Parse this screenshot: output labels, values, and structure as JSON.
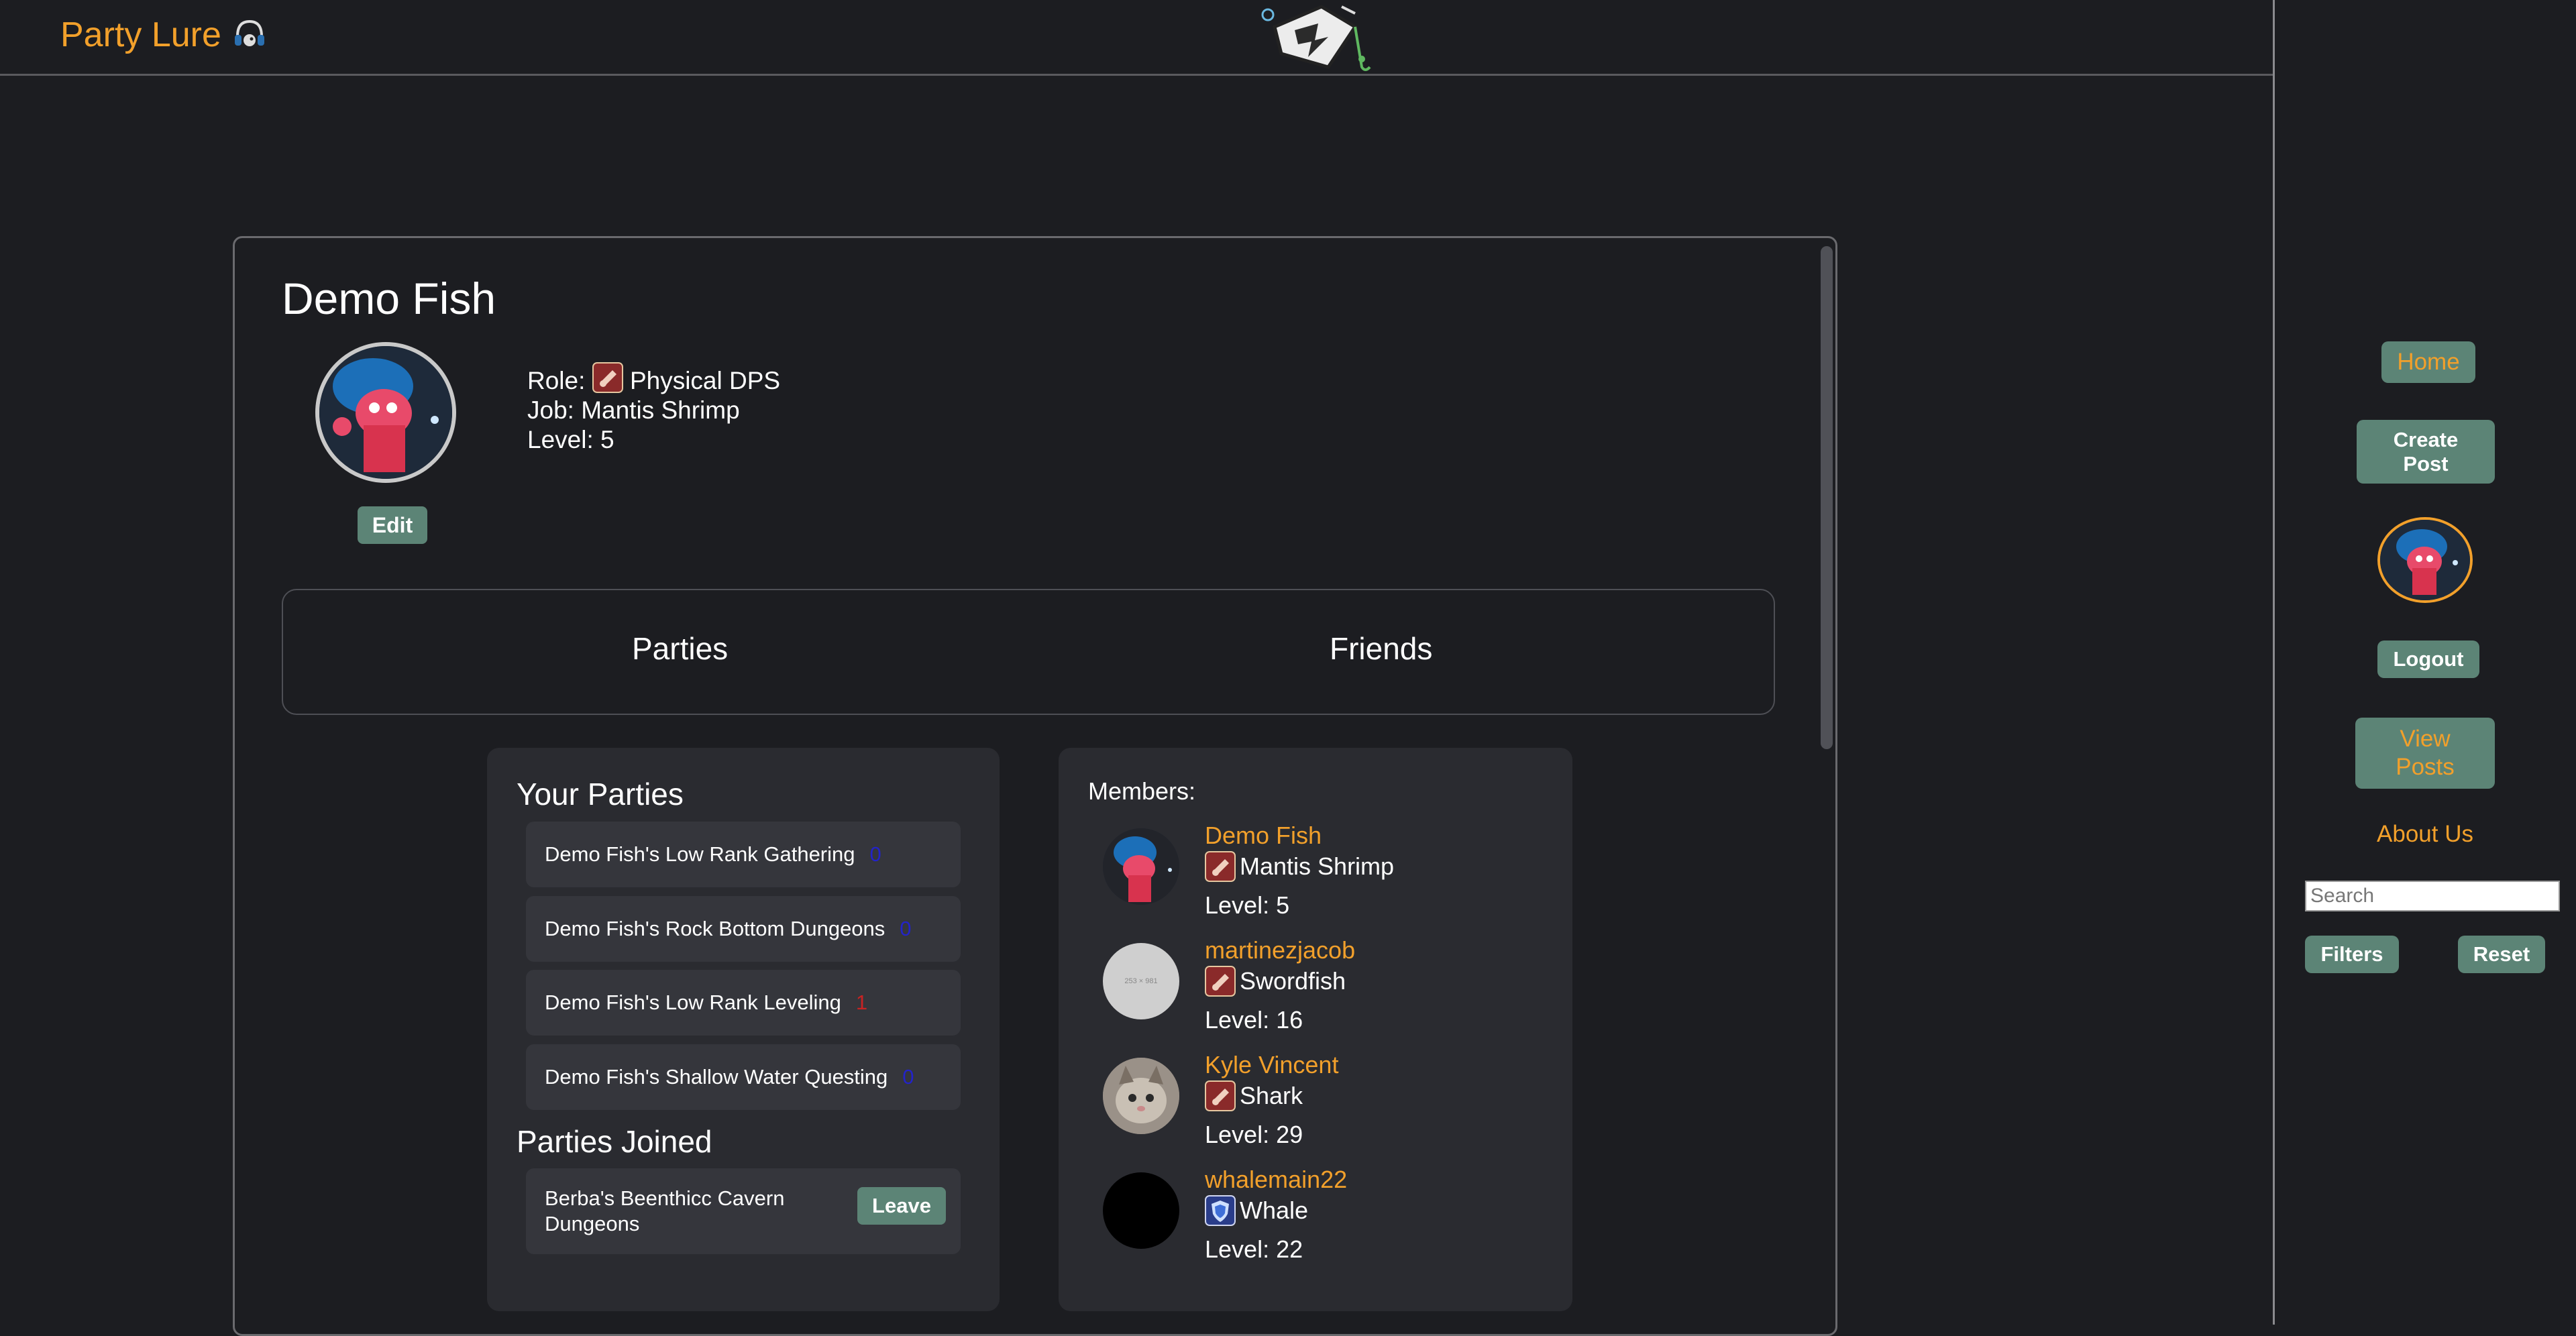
{
  "header": {
    "brand": "Party Lure"
  },
  "sidebar": {
    "home": "Home",
    "create_post": "Create Post",
    "logout": "Logout",
    "view_posts": "View Posts",
    "about": "About Us",
    "search_placeholder": "Search",
    "filters": "Filters",
    "reset": "Reset"
  },
  "profile": {
    "name": "Demo Fish",
    "role_label": "Role:",
    "role": "Physical DPS",
    "job_label": "Job:",
    "job": "Mantis Shrimp",
    "level_label": "Level:",
    "level": "5",
    "edit": "Edit"
  },
  "tabs": [
    "Parties",
    "Friends"
  ],
  "your_parties": {
    "heading": "Your Parties",
    "items": [
      {
        "name": "Demo Fish's Low Rank Gathering",
        "count": "0"
      },
      {
        "name": "Demo Fish's Rock Bottom Dungeons",
        "count": "0"
      },
      {
        "name": "Demo Fish's Low Rank Leveling",
        "count": "1"
      },
      {
        "name": "Demo Fish's Shallow Water Questing",
        "count": "0"
      }
    ]
  },
  "parties_joined": {
    "heading": "Parties Joined",
    "items": [
      {
        "name": "Berba's Beenthicc Cavern Dungeons",
        "action": "Leave"
      }
    ]
  },
  "members": {
    "heading": "Members:",
    "list": [
      {
        "name": "Demo Fish",
        "job": "Mantis Shrimp",
        "level": "Level: 5"
      },
      {
        "name": "martinezjacob",
        "job": "Swordfish",
        "level": "Level: 16"
      },
      {
        "name": "Kyle Vincent",
        "job": "Shark",
        "level": "Level: 29"
      },
      {
        "name": "whalemain22",
        "job": "Whale",
        "level": "Level: 22"
      }
    ]
  },
  "placeholder_avatar_text": "253 × 981",
  "colors": {
    "accent": "#f2a02b",
    "button": "#5c8476",
    "count_zero": "#2323c8",
    "count_one": "#c82323"
  }
}
